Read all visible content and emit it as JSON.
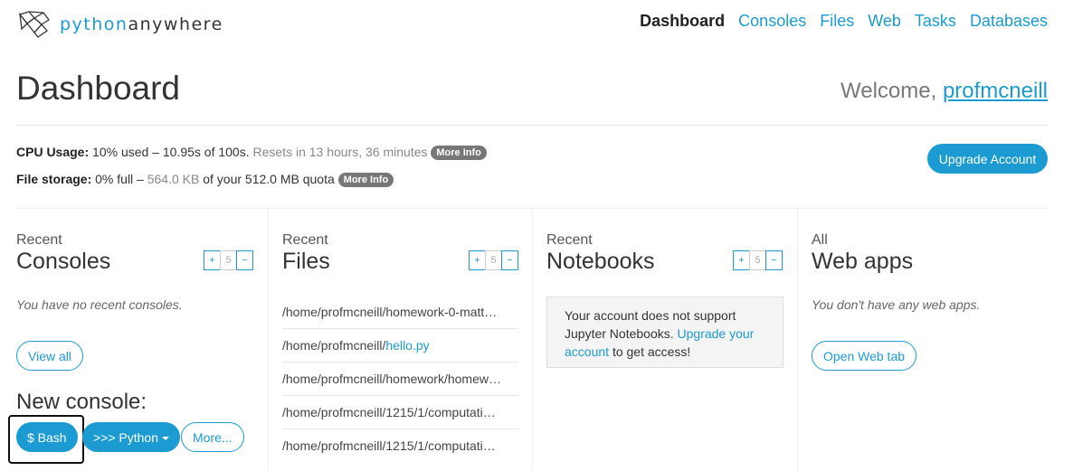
{
  "header": {
    "logo_prefix": "python",
    "logo_suffix": "anywhere",
    "nav": [
      "Dashboard",
      "Consoles",
      "Files",
      "Web",
      "Tasks",
      "Databases"
    ],
    "active_nav": "Dashboard"
  },
  "page": {
    "title": "Dashboard",
    "welcome_text": "Welcome,",
    "username": "profmcneill"
  },
  "usage": {
    "cpu_label": "CPU Usage:",
    "cpu_text": "10% used – 10.95s of 100s.",
    "cpu_reset": "Resets in 13 hours, 36 minutes",
    "file_label": "File storage:",
    "file_text_prefix": "0% full –",
    "file_amount": "564.0 KB",
    "file_text_suffix": "of your 512.0 MB quota",
    "more_info": "More Info",
    "upgrade_button": "Upgrade Account"
  },
  "consoles": {
    "sub": "Recent",
    "head": "Consoles",
    "count": "5",
    "empty": "You have no recent consoles.",
    "view_all": "View all",
    "new_console": "New console:",
    "bash": "$ Bash",
    "python": ">>> Python",
    "more": "More..."
  },
  "files": {
    "sub": "Recent",
    "head": "Files",
    "count": "5",
    "items": [
      {
        "prefix": "/home/profmcneill/homework-0-matt…",
        "link": ""
      },
      {
        "prefix": "/home/profmcneill/",
        "link": "hello.py"
      },
      {
        "prefix": "/home/profmcneill/homework/homew…",
        "link": ""
      },
      {
        "prefix": "/home/profmcneill/1215/1/computati…",
        "link": ""
      },
      {
        "prefix": "/home/profmcneill/1215/1/computati…",
        "link": ""
      }
    ]
  },
  "notebooks": {
    "sub": "Recent",
    "head": "Notebooks",
    "count": "5",
    "notice_text": "Your account does not support Jupyter Notebooks.",
    "notice_link": "Upgrade your account",
    "notice_suffix": "to get access!"
  },
  "webapps": {
    "sub": "All",
    "head": "Web apps",
    "empty": "You don't have any web apps.",
    "open_tab": "Open Web tab"
  },
  "colors": {
    "accent": "#1b9bd1",
    "pill": "#777777"
  }
}
